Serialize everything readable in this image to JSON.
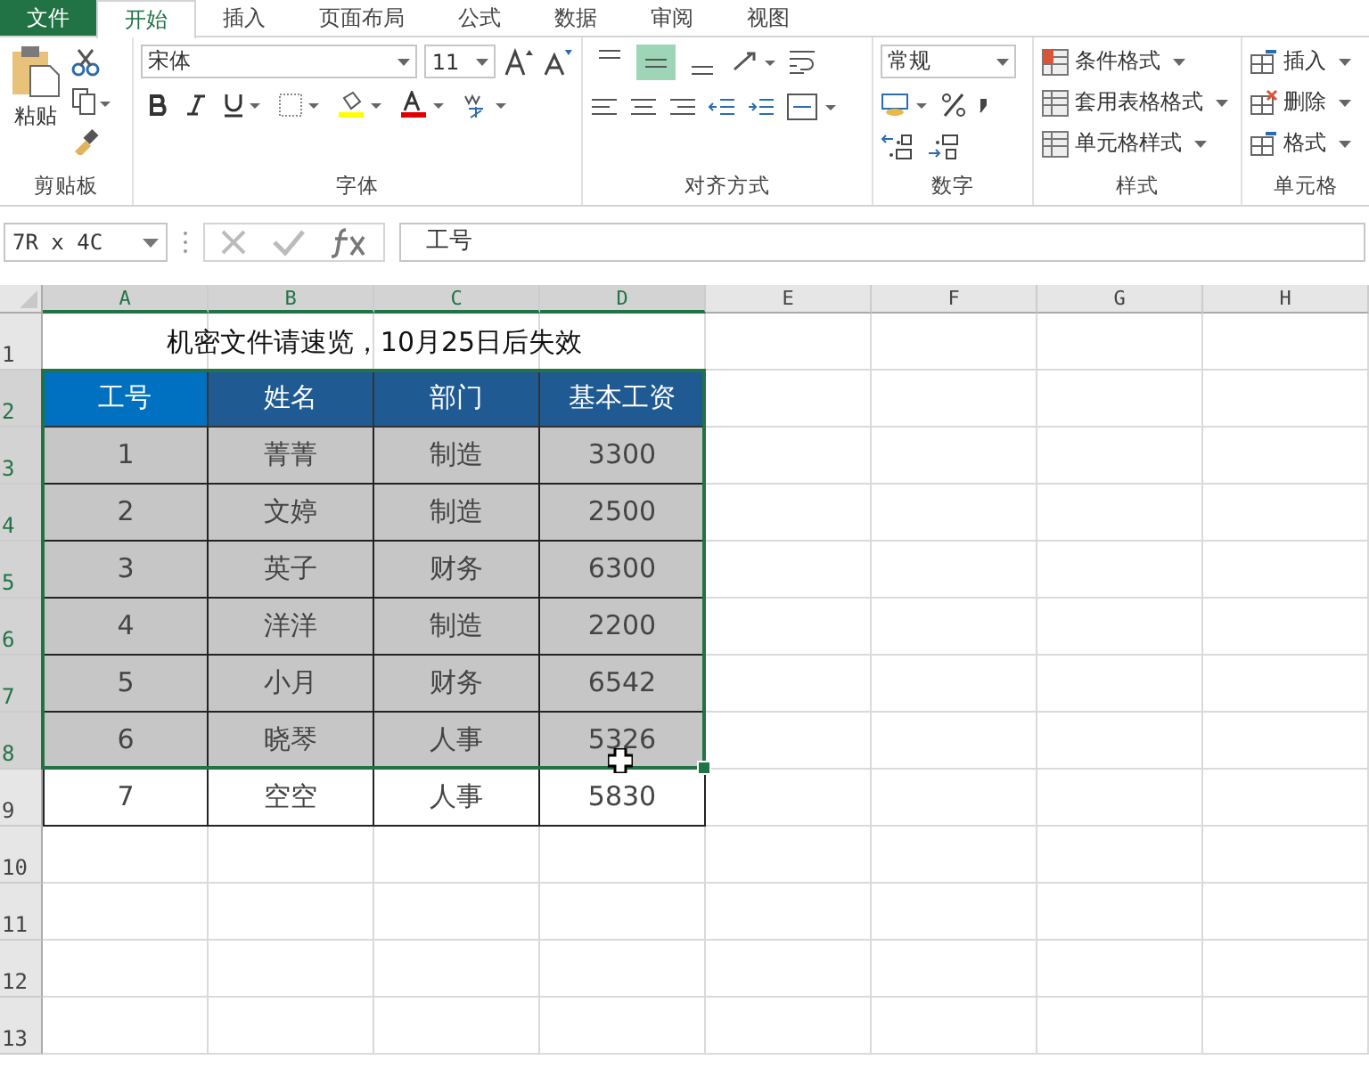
{
  "ribbon_tabs": [
    {
      "label": "文件",
      "kind": "file",
      "selected": false
    },
    {
      "label": "开始",
      "kind": "tab",
      "selected": true
    },
    {
      "label": "插入",
      "kind": "tab",
      "selected": false
    },
    {
      "label": "页面布局",
      "kind": "tab",
      "selected": false
    },
    {
      "label": "公式",
      "kind": "tab",
      "selected": false
    },
    {
      "label": "数据",
      "kind": "tab",
      "selected": false
    },
    {
      "label": "审阅",
      "kind": "tab",
      "selected": false
    },
    {
      "label": "视图",
      "kind": "tab",
      "selected": false
    }
  ],
  "ribbon": {
    "clipboard": {
      "label": "剪贴板",
      "paste": "粘贴"
    },
    "font": {
      "label": "字体",
      "font_name": "宋体",
      "font_size": "11"
    },
    "alignment": {
      "label": "对齐方式",
      "vertical_align": [
        {
          "selected": false
        },
        {
          "selected": true
        },
        {
          "selected": false
        }
      ]
    },
    "number": {
      "label": "数字",
      "format": "常规"
    },
    "styles": {
      "label": "样式",
      "buttons": [
        "条件格式",
        "套用表格格式",
        "单元格样式"
      ]
    },
    "cells": {
      "label": "单元格",
      "buttons": [
        "插入",
        "删除",
        "格式"
      ]
    }
  },
  "formula_bar": {
    "name_box": "7R x 4C",
    "formula": "工号"
  },
  "sheet": {
    "columns": [
      {
        "label": "A",
        "selected": true
      },
      {
        "label": "B",
        "selected": true
      },
      {
        "label": "C",
        "selected": true
      },
      {
        "label": "D",
        "selected": true
      },
      {
        "label": "E",
        "selected": false
      },
      {
        "label": "F",
        "selected": false
      },
      {
        "label": "G",
        "selected": false
      },
      {
        "label": "H",
        "selected": false
      }
    ],
    "row_numbers": [
      {
        "label": "1",
        "selected": false
      },
      {
        "label": "2",
        "selected": true
      },
      {
        "label": "3",
        "selected": true
      },
      {
        "label": "4",
        "selected": true
      },
      {
        "label": "5",
        "selected": true
      },
      {
        "label": "6",
        "selected": true
      },
      {
        "label": "7",
        "selected": true
      },
      {
        "label": "8",
        "selected": true
      },
      {
        "label": "9",
        "selected": false
      },
      {
        "label": "10",
        "selected": false
      },
      {
        "label": "11",
        "selected": false
      },
      {
        "label": "12",
        "selected": false
      },
      {
        "label": "13",
        "selected": false
      }
    ],
    "title": "机密文件请速览，10月25日后失效",
    "table": {
      "header": [
        "工号",
        "姓名",
        "部门",
        "基本工资"
      ],
      "header_selected": true,
      "rows": [
        {
          "cells": [
            "1",
            "菁菁",
            "制造",
            "3300"
          ],
          "selected": true
        },
        {
          "cells": [
            "2",
            "文婷",
            "制造",
            "2500"
          ],
          "selected": true
        },
        {
          "cells": [
            "3",
            "英子",
            "财务",
            "6300"
          ],
          "selected": true
        },
        {
          "cells": [
            "4",
            "洋洋",
            "制造",
            "2200"
          ],
          "selected": true
        },
        {
          "cells": [
            "5",
            "小月",
            "财务",
            "6542"
          ],
          "selected": true
        },
        {
          "cells": [
            "6",
            "晓琴",
            "人事",
            "5326"
          ],
          "selected": true
        },
        {
          "cells": [
            "7",
            "空空",
            "人事",
            "5830"
          ],
          "selected": false
        }
      ]
    }
  }
}
